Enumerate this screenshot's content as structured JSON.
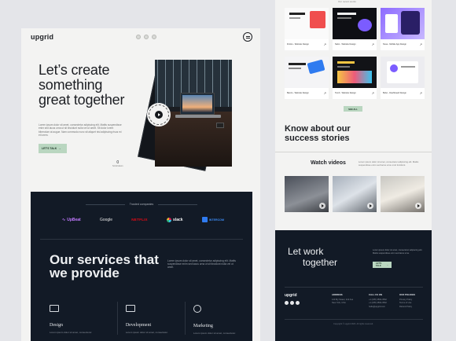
{
  "left_page": {
    "logo": "upgrid",
    "hero": {
      "title": "Let’s create something great together",
      "copy": "Lorem ipsum dolor sit amet, consectetur adipiscing elit. Mattis suspendisse enim sed lacus urna ut sit tincidunt nulla vel ut amet. Sit dolor lorem bibendum at augue. Nam commodo nunc sit aliquet nisl adipiscing risus mi et lorem.",
      "cta_label": "LET'S TALK",
      "scroll_indicator": "0",
      "scroll_label": "Scroll down",
      "badge_text": "LET'S GO"
    },
    "trusted": {
      "label": "Trusted companies",
      "brands": [
        "UpBeat",
        "Google",
        "NETFLIX",
        "slack",
        "INTERCOM"
      ]
    },
    "services": {
      "title": "Our services that we provide",
      "copy": "Lorem ipsum dolor sit amet, consectetur adipiscing elit. Mattis suspendisse enim sed lacus urna ut sit tincidunt nulla vel ut amet.",
      "items": [
        {
          "name": "Design",
          "copy": "Lorem ipsum dolor sit amet, consectetur."
        },
        {
          "name": "Development",
          "copy": "Lorem ipsum dolor sit amet, consectetur."
        },
        {
          "name": "Marketing",
          "copy": "Lorem ipsum dolor sit amet, consectetur."
        }
      ]
    }
  },
  "right_page": {
    "works_caption": "Our recent works",
    "works": [
      {
        "caption": "Fintics - Website Design"
      },
      {
        "caption": "Nebo - Website Design"
      },
      {
        "caption": "Nova - Mobile App Design"
      },
      {
        "caption": "Banzo - Website Design"
      },
      {
        "caption": "Tom3 - Website Design"
      },
      {
        "caption": "Bubo - Dashboard Design"
      }
    ],
    "see_all": "SEE ALL",
    "success_title": "Know about our success stories",
    "watch_title": "Watch videos",
    "watch_copy": "Lorem ipsum dolor sit amet, consectetur adipiscing elit. Mattis suspendisse enim sed lacus urna ut sit tincidunt.",
    "cta": {
      "title_1": "Let work",
      "title_2": "together",
      "copy": "Lorem ipsum dolor sit amet, consectetur adipiscing elit. Mattis suspendisse enim sed lacus urna.",
      "button": "LET'S TALK"
    },
    "footer": {
      "logo": "upgrid",
      "address_title": "ADDRESS",
      "address": [
        "123 My Sweet, 2nd Ave",
        "New York, USA"
      ],
      "call_title": "CALL US ON",
      "call": [
        "+1 (235) 4562-3562",
        "+1 (235) 4562-3562",
        "hello@upgrid.com"
      ],
      "policy_title": "OUR POLICIES",
      "policies": [
        "Privacy Policy",
        "Terms of Use",
        "Refund Policy"
      ],
      "copyright": "Copyright © upgrid 2023. All rights reserved."
    }
  },
  "colors": {
    "dark_section": "#121a26",
    "accent_green": "#b9d6c0",
    "page_bg": "#f3f3f2"
  }
}
